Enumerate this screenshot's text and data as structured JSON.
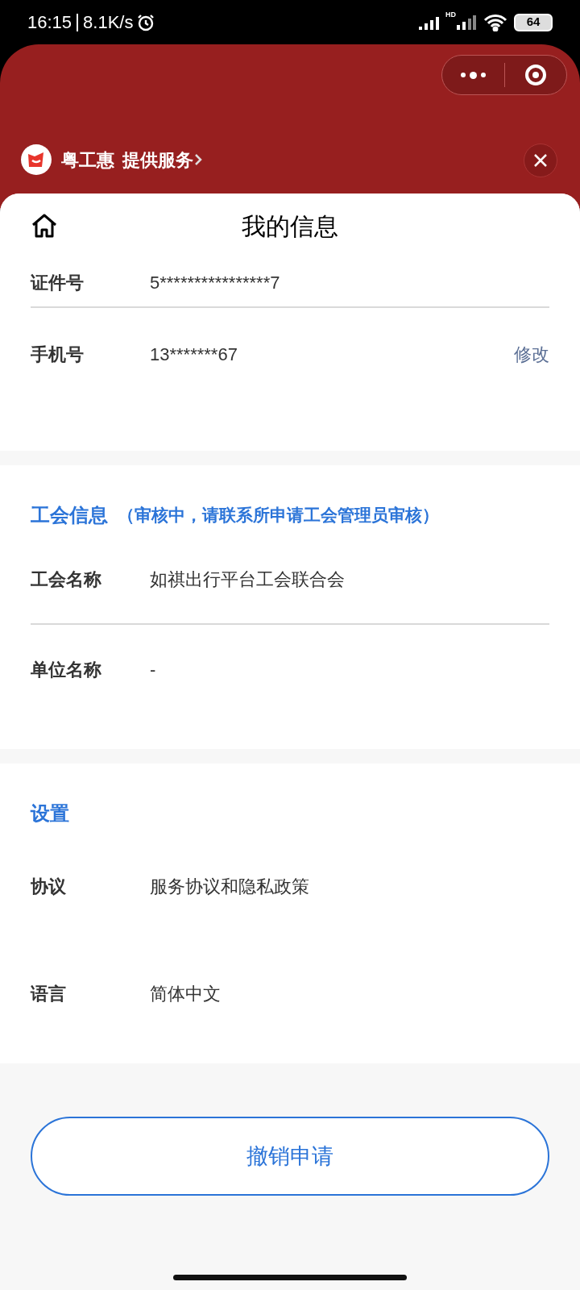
{
  "status_bar": {
    "time": "16:15",
    "speed": "8.1K/s",
    "network_badge": "HD",
    "battery": "64"
  },
  "host_bar": {
    "provider": "粤工惠",
    "service_link": "提供服务"
  },
  "page": {
    "title": "我的信息"
  },
  "sections": [
    {
      "rows": [
        {
          "label": "证件号",
          "value": "5****************7",
          "divider": true
        },
        {
          "label": "手机号",
          "value": "13*******67",
          "action": "修改",
          "divider": false
        }
      ]
    },
    {
      "title": "工会信息",
      "note": "（审核中，请联系所申请工会管理员审核）",
      "rows": [
        {
          "label": "工会名称",
          "value": "如祺出行平台工会联合会",
          "divider": true
        },
        {
          "label": "单位名称",
          "value": "-",
          "divider": false
        }
      ]
    },
    {
      "title": "设置",
      "rows": [
        {
          "label": "协议",
          "value": "服务协议和隐私政策",
          "divider": false
        },
        {
          "label": "语言",
          "value": "简体中文",
          "divider": false
        }
      ]
    }
  ],
  "cancel_button": "撤销申请"
}
